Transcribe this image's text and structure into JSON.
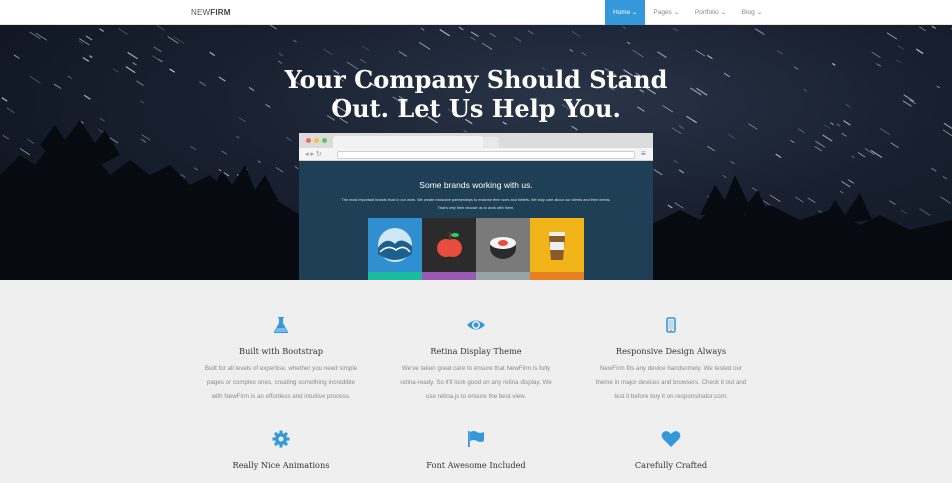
{
  "navbar": {
    "brand_light": "NEW",
    "brand_bold": "FIRM",
    "items": [
      {
        "label": "Home"
      },
      {
        "label": "Pages"
      },
      {
        "label": "Portfolio"
      },
      {
        "label": "Blog"
      }
    ]
  },
  "hero": {
    "title_line1": "Your Company Should Stand",
    "title_line2": "Out. Let Us Help You.",
    "browser": {
      "heading": "Some brands working with us.",
      "sub_line1": "The most important brands trust in our work. We create exclusive partnerships to endorse their work and beliefs. We truly care about our clients and their needs.",
      "sub_line2": "That's why their choose us to work with them."
    },
    "tile_colors": [
      "#2f8fd0",
      "#2b2b2b",
      "#7a7a7a",
      "#f1b419"
    ],
    "tile_foot_colors": [
      "#1abc9c",
      "#9b59b6",
      "#95a5a6",
      "#e67e22"
    ]
  },
  "features": [
    {
      "icon": "flask-icon",
      "title": "Built with Bootstrap",
      "lines": [
        "Built for all levels of expertise, whether you need simple",
        "pages or complex ones, creating something incredible",
        "with NewFirm is an effortless and intuitive process."
      ]
    },
    {
      "icon": "eye-icon",
      "title": "Retina Display Theme",
      "lines": [
        "We've taken great care to ensure that NewFirm is fully",
        "retina-ready. So it'll look good on any retina display. We",
        "use retina.js to ensure the best view."
      ]
    },
    {
      "icon": "mobile-icon",
      "title": "Responsive Design Always",
      "lines": [
        "NewFirm fits any device handsomely. We tested our",
        "theme in major devices and browsers. Check it out and",
        "test it before buy it on responsinator.com."
      ]
    },
    {
      "icon": "gear-icon",
      "title": "Really Nice Animations",
      "lines": []
    },
    {
      "icon": "flag-icon",
      "title": "Font Awesome Included",
      "lines": []
    },
    {
      "icon": "heart-icon",
      "title": "Carefully Crafted",
      "lines": []
    }
  ],
  "colors": {
    "accent": "#3498db",
    "hero_bg": "#1a2232",
    "features_bg": "#efefef"
  }
}
